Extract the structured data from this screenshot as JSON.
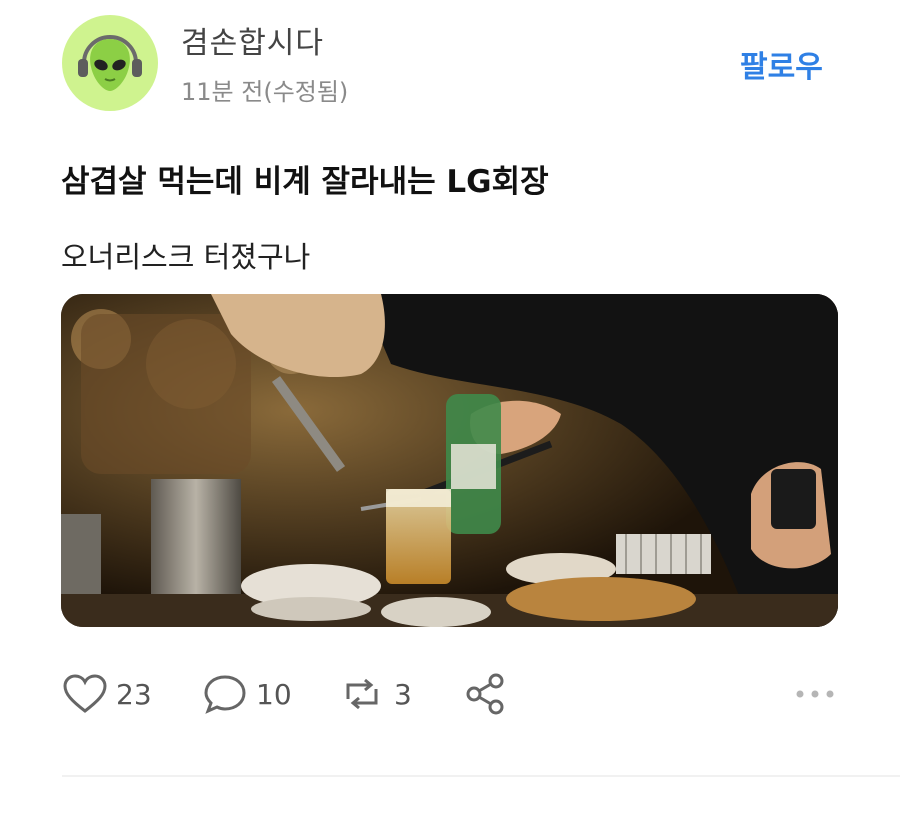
{
  "post": {
    "author": {
      "name": "겸손합시다",
      "avatar_icon": "alien-headphones-avatar-icon"
    },
    "timestamp": "11분 전(수정됨)",
    "follow_label": "팔로우",
    "title": "삼겹살 먹는데 비계 잘라내는 LG회장",
    "body": "오너리스크 터졌구나",
    "actions": {
      "likes": "23",
      "comments": "10",
      "reposts": "3"
    }
  },
  "colors": {
    "accent": "#2f80e5",
    "avatar_bg": "#cff38f"
  }
}
